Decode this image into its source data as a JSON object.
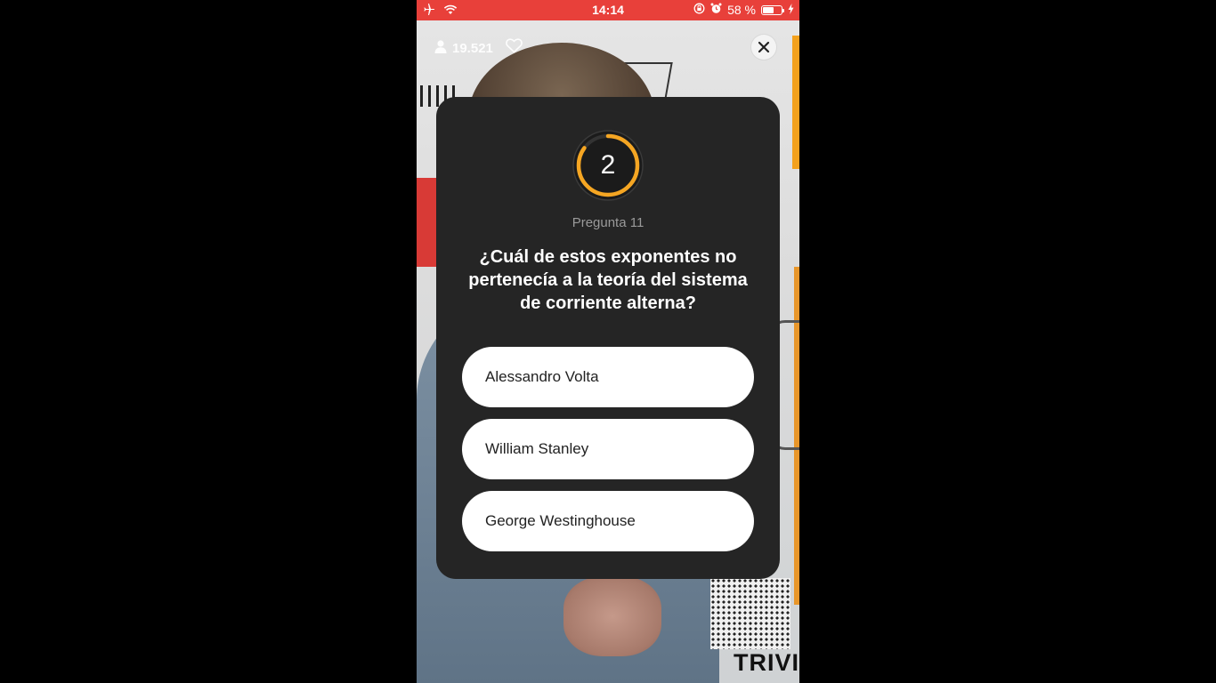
{
  "status_bar": {
    "time": "14:14",
    "battery_percent": "58 %",
    "battery_level": 0.58,
    "icons": [
      "airplane-icon",
      "wifi-icon",
      "orientation-lock-icon",
      "alarm-icon",
      "battery-icon",
      "charging-icon"
    ]
  },
  "overlay": {
    "viewer_count": "19.521",
    "icons": [
      "person-icon",
      "heart-icon",
      "close-icon"
    ]
  },
  "quiz": {
    "timer_value": "2",
    "timer_progress": 0.85,
    "question_number": "Pregunta 11",
    "question": "¿Cuál de estos exponentes no pertenecía a la teoría del sistema de corriente alterna?",
    "answers": [
      {
        "label": "Alessandro Volta"
      },
      {
        "label": "William Stanley"
      },
      {
        "label": "George Westinghouse"
      }
    ]
  },
  "background": {
    "brand_text": "TRIVIA"
  },
  "colors": {
    "status_bar": "#e8403a",
    "card": "#252525",
    "timer_ring": "#f5a623",
    "answer_bg": "#ffffff"
  }
}
